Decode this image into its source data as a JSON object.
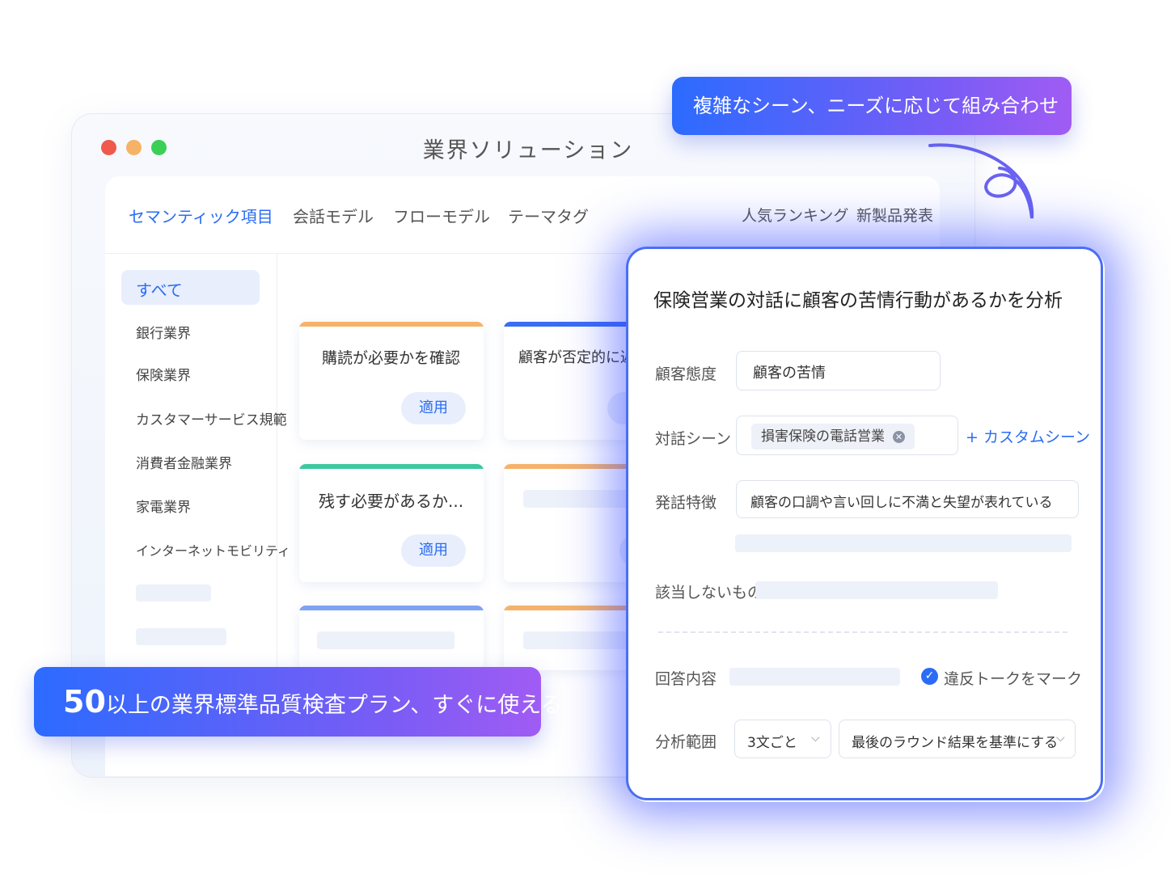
{
  "window": {
    "title": "業界ソリューション",
    "traffic_light_colors": [
      "#ef5a4c",
      "#f6b266",
      "#3ccf58"
    ]
  },
  "tabs": {
    "left": [
      "セマンティック項目",
      "会話モデル",
      "フローモデル",
      "テーマタグ"
    ],
    "right": [
      "人気ランキング",
      "新製品発表"
    ],
    "active_index": 0
  },
  "sidebar": {
    "items": [
      "すべて",
      "銀行業界",
      "保険業界",
      "カスタマーサービス規範",
      "消費者金融業界",
      "家電業界",
      "インターネットモビリティ"
    ],
    "active_index": 0
  },
  "cards": [
    {
      "text": "購読が必要かを確認",
      "button": "適用",
      "accent": "#f6b26b"
    },
    {
      "text": "顧客が否定的に返",
      "button": "",
      "accent": "#3b6cf6"
    },
    {
      "text": "残す必要があるか...",
      "button": "適用",
      "accent": "#3cc9a0"
    },
    {
      "text": "",
      "button": "",
      "accent": "#f6b26b"
    },
    {
      "text": "",
      "button": "",
      "accent": "#7fa2f5"
    },
    {
      "text": "",
      "button": "",
      "accent": "#f6b26b"
    }
  ],
  "callouts": {
    "top": "複雑なシーン、ニーズに応じて組み合わせ",
    "bottom_number": "50",
    "bottom_text": "以上の業界標準品質検査プラン、すぐに使える"
  },
  "panel": {
    "title": "保険営業の対話に顧客の苦情行動があるかを分析",
    "customer_attitude": {
      "label": "顧客態度",
      "value": "顧客の苦情"
    },
    "dialogue_scene": {
      "label": "対話シーン",
      "chip": "損害保険の電話営業",
      "custom_link": "+ カスタムシーン"
    },
    "utterance": {
      "label": "発話特徴",
      "value": "顧客の口調や言い回しに不満と失望が表れている"
    },
    "not_applicable": {
      "label": "該当しないもの"
    },
    "answer": {
      "label": "回答内容",
      "checkbox_label": "違反トークをマーク",
      "checked": true
    },
    "scope": {
      "label": "分析範囲",
      "select1": "3文ごと",
      "select2": "最後のラウンド結果を基準にする"
    },
    "accent": "#2a6cf6"
  }
}
